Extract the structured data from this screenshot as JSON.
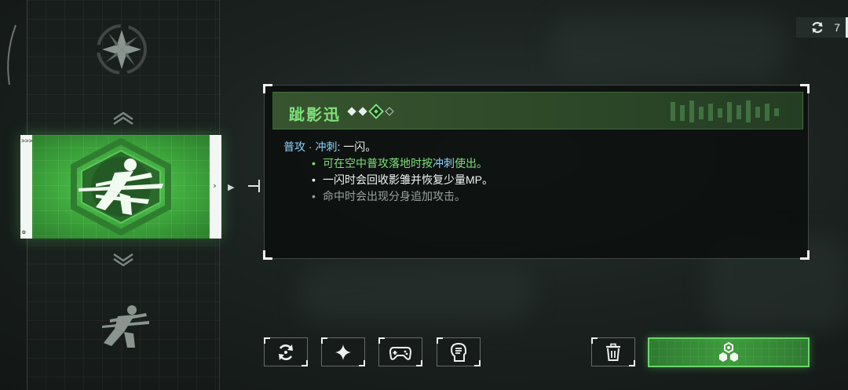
{
  "skill": {
    "name": "跐影迅",
    "level_current": 3,
    "level_max": 4
  },
  "description": {
    "type_label": "普攻 · 冲刺",
    "type_sep": ":",
    "type_value": "一闪。",
    "bullets": [
      {
        "parts": [
          "可在空中普攻落地时按",
          "冲刺",
          "使出。"
        ]
      },
      {
        "text": "一闪时会回收影雏并恢复少量MP。"
      },
      {
        "text": "命中时会出现分身追加攻击。"
      }
    ]
  },
  "reset_counter": {
    "value": "7",
    "icon": "refresh-icon"
  },
  "buttons": {
    "swap": {
      "icon": "swap-icon"
    },
    "enhance": {
      "icon": "sparkle-icon"
    },
    "controller": {
      "icon": "gamepad-icon"
    },
    "hint": {
      "icon": "head-bulb-icon"
    },
    "discard": {
      "icon": "trash-icon"
    },
    "equip": {
      "icon": "module-icon"
    }
  },
  "rail": {
    "skills": [
      {
        "icon": "shuriken-icon",
        "state": "dim"
      },
      {
        "icon": "dash-slash-icon",
        "state": "selected"
      },
      {
        "icon": "dash-runner-icon",
        "state": "dim"
      }
    ]
  },
  "colors": {
    "accent_green": "#7fe07a",
    "keyword_blue": "#8ad4ff",
    "disabled_text": "#9aa39e",
    "panel_bg": "#0a0e0c"
  }
}
